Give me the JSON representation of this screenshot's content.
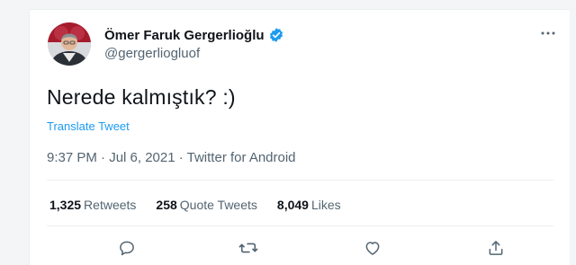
{
  "tweet": {
    "author": {
      "name": "Ömer Faruk Gergerlioğlu",
      "handle": "@gergerliogluof"
    },
    "text": "Nerede kalmıştık? :)",
    "translate_label": "Translate Tweet",
    "meta": "9:37 PM · Jul 6, 2021 · Twitter for Android",
    "stats": {
      "retweets_count": "1,325",
      "retweets_label": "Retweets",
      "quote_count": "258",
      "quote_label": "Quote Tweets",
      "likes_count": "8,049",
      "likes_label": "Likes"
    }
  },
  "icons": {
    "more": "more-horizontal-icon",
    "verified": "verified-badge-icon",
    "reply": "reply-icon",
    "retweet": "retweet-icon",
    "like": "like-icon",
    "share": "share-icon"
  },
  "colors": {
    "accent": "#1d9bf0",
    "text": "#0f1419",
    "secondary": "#536471"
  }
}
